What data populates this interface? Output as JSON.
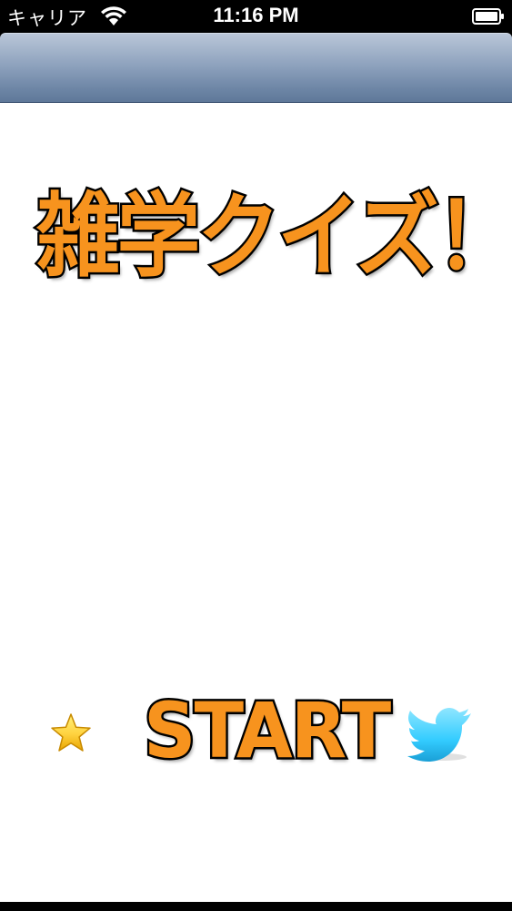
{
  "status_bar": {
    "carrier": "キャリア",
    "time": "11:16 PM"
  },
  "nav_bar": {
    "title": ""
  },
  "main": {
    "title": "雑学クイズ！",
    "start_label": "START",
    "left_icon": "star-icon",
    "right_icon": "twitter-bird-icon"
  },
  "colors": {
    "text_fill": "#f7931e",
    "text_outline": "#000000",
    "nav_gradient_top": "#b9c6d8",
    "nav_gradient_bottom": "#5f7899",
    "background": "#ffffff",
    "star_fill": "#ffd23f",
    "twitter_blue": "#33ccff"
  }
}
